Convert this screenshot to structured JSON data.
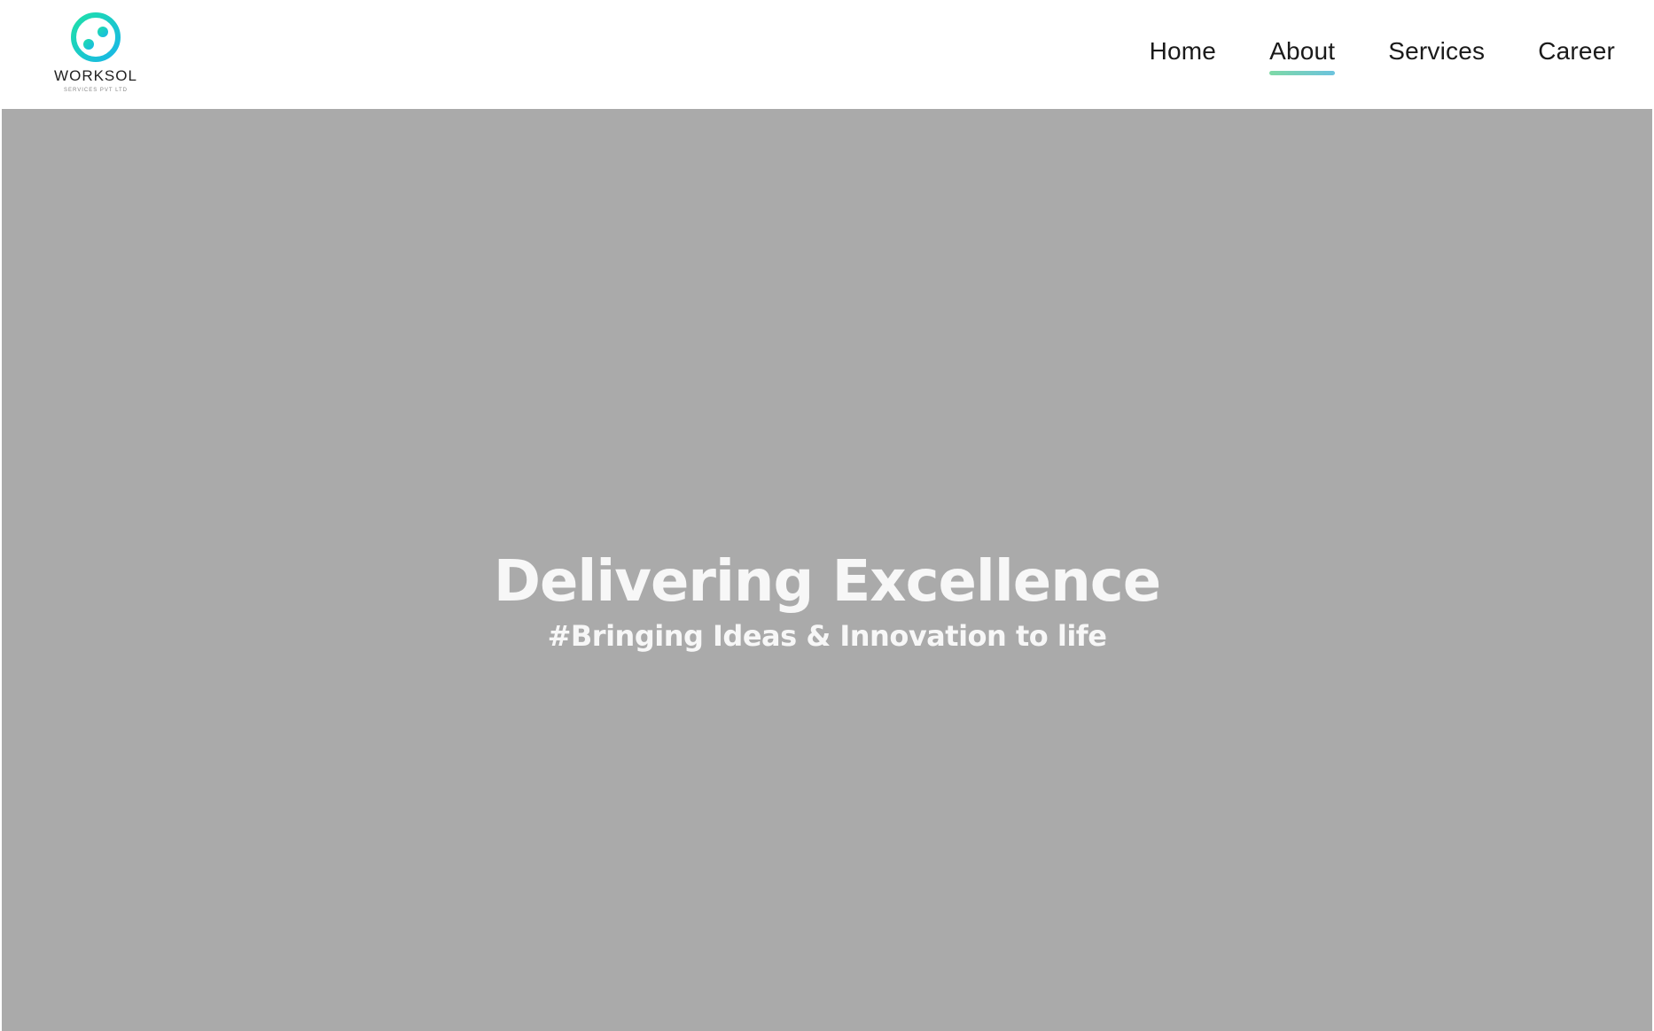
{
  "brand": {
    "name": "WORKSOL",
    "tagline": "SERVICES PVT LTD",
    "colors": {
      "accent_start": "#1ee0a8",
      "accent_end": "#18b6e8"
    }
  },
  "nav": {
    "items": [
      {
        "label": "Home",
        "active": false
      },
      {
        "label": "About",
        "active": true
      },
      {
        "label": "Services",
        "active": false
      },
      {
        "label": "Career",
        "active": false
      }
    ],
    "active_underline_color": "#7ed9a6"
  },
  "hero": {
    "title": "Delivering Excellence",
    "subtitle": "#Bringing Ideas & Innovation to life",
    "background_color": "#aaaaaa"
  }
}
